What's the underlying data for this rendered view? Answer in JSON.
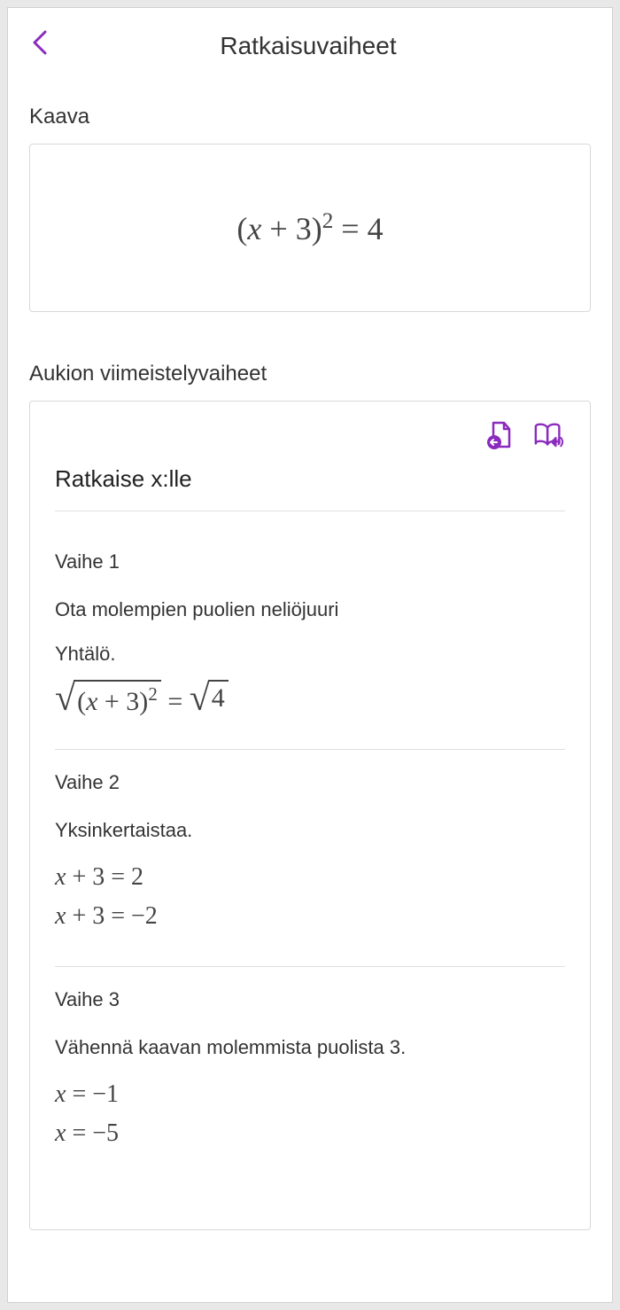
{
  "header": {
    "title": "Ratkaisuvaiheet"
  },
  "formula": {
    "label": "Kaava",
    "expr_html": "(<span class='italic'>x</span> + 3)<span class='sup'>2</span> = 4"
  },
  "steps_section": {
    "label": "Aukion viimeistelyvaiheet",
    "solve_title": "Ratkaise x:lle",
    "steps": [
      {
        "label": "Vaihe 1",
        "desc": "Ota molempien puolien neliöjuuri",
        "subdesc": "Yhtälö.",
        "math_html": "<span class='sqrt-wrap'><span class='sqrt-sign'>√</span><span class='sqrt-body'>(<span class='italic'>x</span> + 3)<span class='sup'>2</span></span></span> = <span class='sqrt-wrap'><span class='sqrt-sign'>√</span><span class='sqrt-body'>4</span></span>"
      },
      {
        "label": "Vaihe 2",
        "desc": "Yksinkertaistaa.",
        "subdesc": "",
        "math_lines": [
          "<span class='italic'>x</span> + 3 = 2",
          "<span class='italic'>x</span> + 3 = −2"
        ]
      },
      {
        "label": "Vaihe 3",
        "desc": "Vähennä kaavan molemmista puolista 3.",
        "subdesc": "",
        "math_lines": [
          "<span class='italic'>x</span> = −1",
          "<span class='italic'>x</span> = −5"
        ]
      }
    ]
  }
}
